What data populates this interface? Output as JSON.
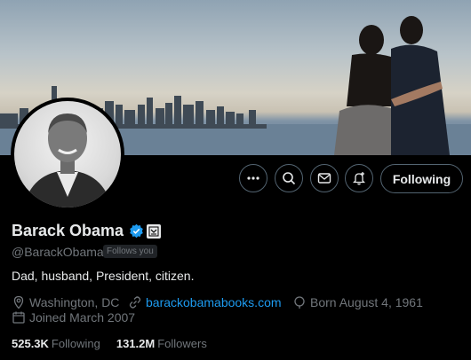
{
  "profile": {
    "name": "Barack Obama",
    "handle": "@BarackObama",
    "follows_you": "Follows you",
    "bio": "Dad, husband, President, citizen.",
    "location": "Washington, DC",
    "website": "barackobamabooks.com",
    "born": "Born August 4, 1961",
    "joined": "Joined March 2007",
    "following_count": "525.3K",
    "following_label": "Following",
    "followers_count": "131.2M",
    "followers_label": "Followers"
  },
  "actions": {
    "follow_button_label": "Following"
  },
  "colors": {
    "background": "#000000",
    "text_primary": "#e7e9ea",
    "text_secondary": "#71767b",
    "link": "#1d9bf0",
    "verified": "#1d9bf0"
  },
  "icons": [
    "more-icon",
    "search-icon",
    "message-icon",
    "notify-icon",
    "verified-badge-icon",
    "location-icon",
    "link-icon",
    "birthday-icon",
    "calendar-icon"
  ]
}
